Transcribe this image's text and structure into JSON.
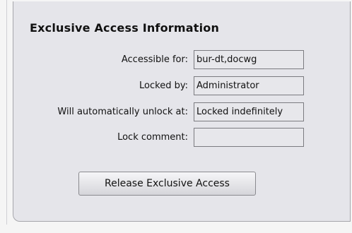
{
  "section": {
    "title": "Exclusive Access Information"
  },
  "fields": {
    "accessible_for": {
      "label": "Accessible for:",
      "value": "bur-dt,docwg"
    },
    "locked_by": {
      "label": "Locked by:",
      "value": "Administrator"
    },
    "auto_unlock": {
      "label": "Will automatically unlock at:",
      "value": "Locked indefinitely"
    },
    "lock_comment": {
      "label": "Lock comment:",
      "value": ""
    }
  },
  "actions": {
    "release_label": "Release Exclusive Access"
  }
}
